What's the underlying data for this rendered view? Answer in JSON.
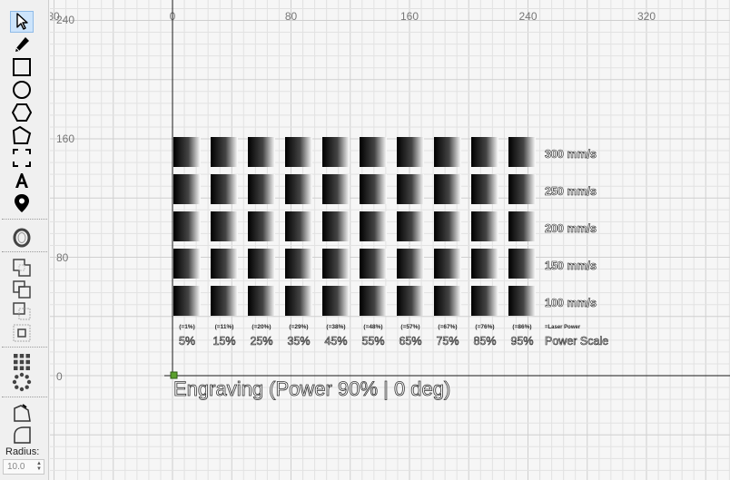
{
  "toolbar": {
    "tools": [
      {
        "name": "select-tool",
        "icon": "cursor-arrow-icon",
        "active": true
      },
      {
        "name": "pencil-tool",
        "icon": "pencil-icon"
      },
      {
        "name": "rectangle-tool",
        "icon": "rectangle-icon"
      },
      {
        "name": "ellipse-tool",
        "icon": "circle-icon"
      },
      {
        "name": "polygon-tool",
        "icon": "hexagon-icon"
      },
      {
        "name": "pentagon-tool",
        "icon": "pentagon-icon"
      },
      {
        "name": "corner-rect-tool",
        "icon": "corners-icon"
      },
      {
        "name": "text-tool",
        "icon": "text-a-icon"
      },
      {
        "name": "position-tool",
        "icon": "location-pin-icon"
      },
      {
        "name": "offset-tool",
        "icon": "offset-ring-icon"
      },
      {
        "name": "union-tool",
        "icon": "union-icon"
      },
      {
        "name": "subtract-tool",
        "icon": "subtract-icon"
      },
      {
        "name": "intersect-tool",
        "icon": "intersect-icon"
      },
      {
        "name": "inner-tool",
        "icon": "inner-square-icon"
      },
      {
        "name": "grid-array-tool",
        "icon": "grid-array-icon"
      },
      {
        "name": "circular-array-tool",
        "icon": "circular-array-icon"
      },
      {
        "name": "corner-edit-tool",
        "icon": "corner-edit-icon"
      },
      {
        "name": "round-corner-tool",
        "icon": "round-corner-icon"
      }
    ],
    "radius_label": "Radius:",
    "radius_value": "10.0"
  },
  "canvas": {
    "x_ticks": [
      "0",
      "80",
      "160",
      "240",
      "320"
    ],
    "x_ticks_partial": "80",
    "y_ticks": [
      "240",
      "160",
      "80",
      "0"
    ],
    "speed_labels": [
      "300 mm/s",
      "250 mm/s",
      "200 mm/s",
      "150 mm/s",
      "100 mm/s"
    ],
    "laser_power_values": [
      "(=1%)",
      "(=11%)",
      "(=20%)",
      "(=29%)",
      "(=38%)",
      "(=48%)",
      "(=57%)",
      "(=67%)",
      "(=76%)",
      "(=86%)"
    ],
    "laser_power_caption": "=Laser Power",
    "power_scale_values": [
      "5%",
      "15%",
      "25%",
      "35%",
      "45%",
      "55%",
      "65%",
      "75%",
      "85%",
      "95%"
    ],
    "power_scale_caption": "Power Scale",
    "footer_title": "Engraving (Power 90% | 0 deg)"
  },
  "colors": {
    "grid_minor": "#e2e2e2",
    "grid_major": "#cfcfcf",
    "axis": "#1a1a1a",
    "origin_marker": "#5aa02c"
  }
}
